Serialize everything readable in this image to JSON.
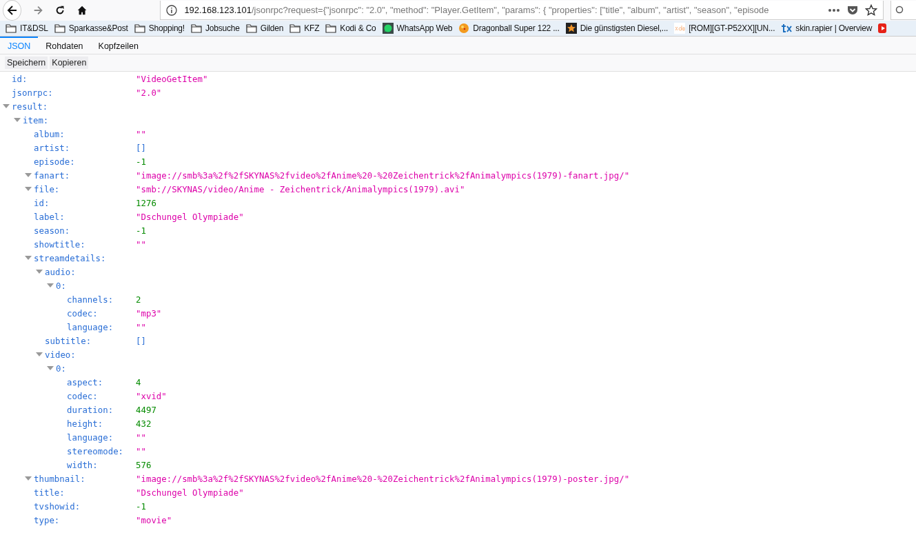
{
  "address_bar": {
    "host": "192.168.123.101",
    "path": "/jsonrpc?request={\"jsonrpc\": \"2.0\", \"method\": \"Player.GetItem\", \"params\": { \"properties\": [\"title\", \"album\", \"artist\", \"season\", \"episode"
  },
  "bookmarks": [
    {
      "label": "IT&DSL",
      "kind": "folder"
    },
    {
      "label": "Sparkasse&Post",
      "kind": "folder"
    },
    {
      "label": "Shopping!",
      "kind": "folder"
    },
    {
      "label": "Jobsuche",
      "kind": "folder"
    },
    {
      "label": "Gilden",
      "kind": "folder"
    },
    {
      "label": "KFZ",
      "kind": "folder"
    },
    {
      "label": "Kodi & Co",
      "kind": "folder"
    },
    {
      "label": "WhatsApp Web",
      "kind": "chat"
    },
    {
      "label": "Dragonball Super 122 ...",
      "kind": "ball"
    },
    {
      "label": "Die günstigsten Diesel,...",
      "kind": "star"
    },
    {
      "label": "[ROM][GT-P52XX][UN...",
      "kind": "xda"
    },
    {
      "label": "skin.rapier | Overview",
      "kind": "tx"
    },
    {
      "kind": "play"
    }
  ],
  "tabs": [
    {
      "label": "JSON",
      "selected": true
    },
    {
      "label": "Rohdaten",
      "selected": false
    },
    {
      "label": "Kopfzeilen",
      "selected": false
    }
  ],
  "buttons": [
    "Speichern",
    "Kopieren"
  ],
  "tree": [
    {
      "key": "id:",
      "value": "\"VideoGetItem\"",
      "kind": "string"
    },
    {
      "key": "jsonrpc:",
      "value": "\"2.0\"",
      "kind": "string"
    },
    {
      "key": "result:",
      "expanded": true,
      "children": [
        {
          "key": "item:",
          "expanded": true,
          "children": [
            {
              "key": "album:",
              "value": "\"\"",
              "kind": "string"
            },
            {
              "key": "artist:",
              "value": "[]",
              "kind": "array"
            },
            {
              "key": "episode:",
              "value": "-1",
              "kind": "number"
            },
            {
              "key": "fanart:",
              "expanded": true,
              "value": "\"image://smb%3a%2f%2fSKYNAS%2fvideo%2fAnime%20-%20Zeichentrick%2fAnimalympics(1979)-fanart.jpg/\"",
              "kind": "string"
            },
            {
              "key": "file:",
              "expanded": true,
              "value": "\"smb://SKYNAS/video/Anime - Zeichentrick/Animalympics(1979).avi\"",
              "kind": "string"
            },
            {
              "key": "id:",
              "value": "1276",
              "kind": "number"
            },
            {
              "key": "label:",
              "value": "\"Dschungel Olympiade\"",
              "kind": "string"
            },
            {
              "key": "season:",
              "value": "-1",
              "kind": "number"
            },
            {
              "key": "showtitle:",
              "value": "\"\"",
              "kind": "string"
            },
            {
              "key": "streamdetails:",
              "expanded": true,
              "children": [
                {
                  "key": "audio:",
                  "expanded": true,
                  "children": [
                    {
                      "key": "0:",
                      "expanded": true,
                      "children": [
                        {
                          "key": "channels:",
                          "value": "2",
                          "kind": "number"
                        },
                        {
                          "key": "codec:",
                          "value": "\"mp3\"",
                          "kind": "string"
                        },
                        {
                          "key": "language:",
                          "value": "\"\"",
                          "kind": "string"
                        }
                      ]
                    }
                  ]
                },
                {
                  "key": "subtitle:",
                  "value": "[]",
                  "kind": "array"
                },
                {
                  "key": "video:",
                  "expanded": true,
                  "children": [
                    {
                      "key": "0:",
                      "expanded": true,
                      "children": [
                        {
                          "key": "aspect:",
                          "value": "4",
                          "kind": "number"
                        },
                        {
                          "key": "codec:",
                          "value": "\"xvid\"",
                          "kind": "string"
                        },
                        {
                          "key": "duration:",
                          "value": "4497",
                          "kind": "number"
                        },
                        {
                          "key": "height:",
                          "value": "432",
                          "kind": "number"
                        },
                        {
                          "key": "language:",
                          "value": "\"\"",
                          "kind": "string"
                        },
                        {
                          "key": "stereomode:",
                          "value": "\"\"",
                          "kind": "string"
                        },
                        {
                          "key": "width:",
                          "value": "576",
                          "kind": "number"
                        }
                      ]
                    }
                  ]
                }
              ]
            },
            {
              "key": "thumbnail:",
              "expanded": true,
              "value": "\"image://smb%3a%2f%2fSKYNAS%2fvideo%2fAnime%20-%20Zeichentrick%2fAnimalympics(1979)-poster.jpg/\"",
              "kind": "string"
            },
            {
              "key": "title:",
              "value": "\"Dschungel Olympiade\"",
              "kind": "string"
            },
            {
              "key": "tvshowid:",
              "value": "-1",
              "kind": "number"
            },
            {
              "key": "type:",
              "value": "\"movie\"",
              "kind": "string"
            }
          ]
        }
      ]
    }
  ]
}
